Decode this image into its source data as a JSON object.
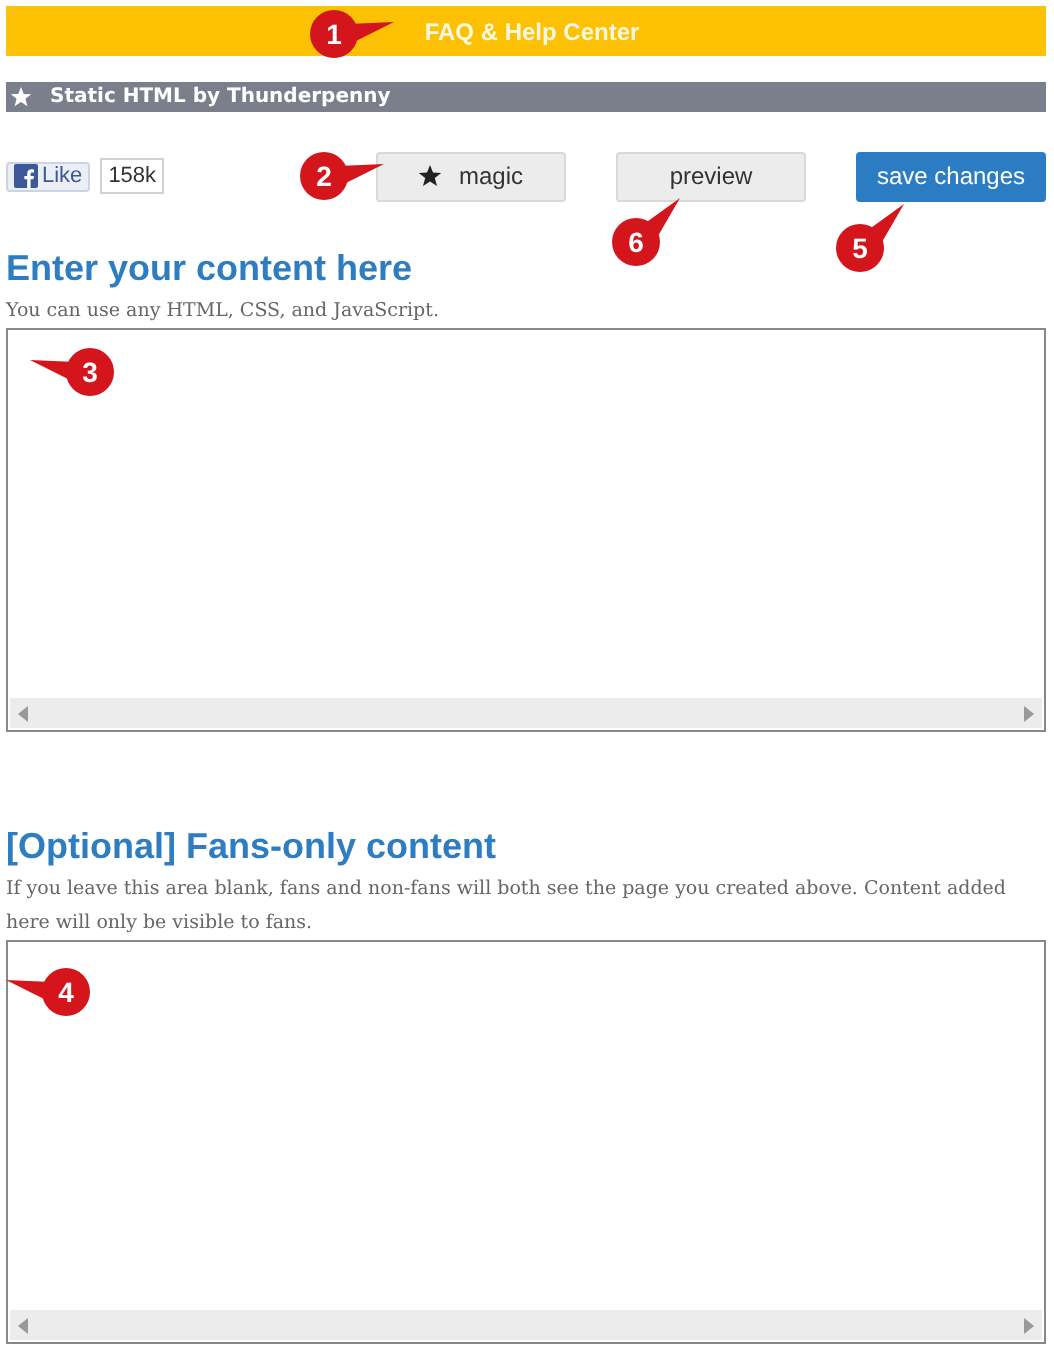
{
  "banner": {
    "title": "FAQ & Help Center"
  },
  "app_bar": {
    "title": "Static HTML by Thunderpenny"
  },
  "like_button": {
    "label": "Like",
    "count": "158k"
  },
  "toolbar": [
    {
      "label": "magic",
      "kind": "icon",
      "primary": false
    },
    {
      "label": "preview",
      "kind": "plain",
      "primary": false
    },
    {
      "label": "save changes",
      "kind": "plain",
      "primary": true
    }
  ],
  "sections": [
    {
      "heading": "Enter your content here",
      "description": "You can use any HTML, CSS, and JavaScript."
    },
    {
      "heading": "[Optional] Fans-only content",
      "description": "If you leave this area blank, fans and non-fans will both see the page you created above. Content added here will only be visible to fans."
    }
  ],
  "callouts": [
    {
      "number": "1"
    },
    {
      "number": "2"
    },
    {
      "number": "3"
    },
    {
      "number": "4"
    },
    {
      "number": "5"
    },
    {
      "number": "6"
    }
  ]
}
